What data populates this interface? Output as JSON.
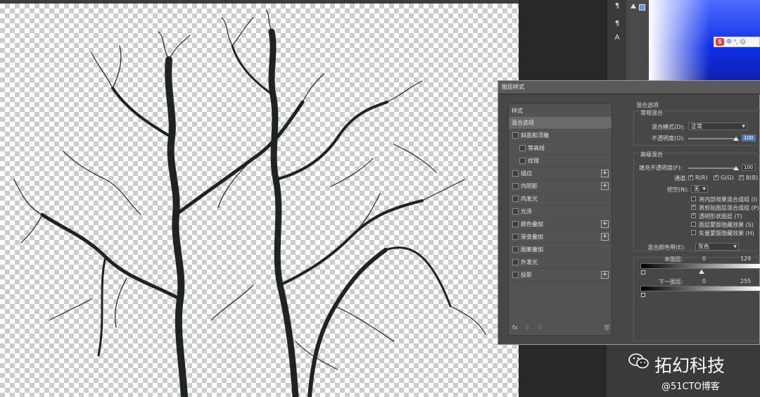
{
  "dialog": {
    "title": "图层样式",
    "styles_header": "样式",
    "styles": [
      {
        "label": "混合选项",
        "active": true,
        "checkbox": false,
        "plus": false,
        "indent": 0
      },
      {
        "label": "斜面和浮雕",
        "active": false,
        "checkbox": true,
        "plus": false,
        "indent": 0
      },
      {
        "label": "等高线",
        "active": false,
        "checkbox": true,
        "plus": false,
        "indent": 1
      },
      {
        "label": "纹理",
        "active": false,
        "checkbox": true,
        "plus": false,
        "indent": 1
      },
      {
        "label": "描边",
        "active": false,
        "checkbox": true,
        "plus": true,
        "indent": 0
      },
      {
        "label": "内阴影",
        "active": false,
        "checkbox": true,
        "plus": true,
        "indent": 0
      },
      {
        "label": "内发光",
        "active": false,
        "checkbox": true,
        "plus": false,
        "indent": 0
      },
      {
        "label": "光泽",
        "active": false,
        "checkbox": true,
        "plus": false,
        "indent": 0
      },
      {
        "label": "颜色叠加",
        "active": false,
        "checkbox": true,
        "plus": true,
        "indent": 0
      },
      {
        "label": "渐变叠加",
        "active": false,
        "checkbox": true,
        "plus": true,
        "indent": 0
      },
      {
        "label": "图案叠加",
        "active": false,
        "checkbox": true,
        "plus": false,
        "indent": 0
      },
      {
        "label": "外发光",
        "active": false,
        "checkbox": true,
        "plus": false,
        "indent": 0
      },
      {
        "label": "投影",
        "active": false,
        "checkbox": true,
        "plus": true,
        "indent": 0
      }
    ],
    "footer": {
      "fx": "fx",
      "up": "⇧",
      "down": "⇩",
      "trash": "🗑"
    },
    "blend_options_title": "混合选项",
    "general_blending": {
      "title": "常规混合",
      "mode_label": "混合模式(D):",
      "mode_value": "正常",
      "opacity_label": "不透明度(O):",
      "opacity_value": "100"
    },
    "advanced_blending": {
      "title": "高级混合",
      "fill_label": "填充不透明度(F):",
      "fill_value": "100",
      "channels_label": "通道:",
      "channels": [
        {
          "label": "R(R)",
          "checked": true
        },
        {
          "label": "G(G)",
          "checked": true
        },
        {
          "label": "B(B)",
          "checked": true
        }
      ],
      "knockout_label": "挖空(N):",
      "knockout_value": "无",
      "options": [
        {
          "label": "将内部效果混合成组 (I)",
          "checked": false
        },
        {
          "label": "将剪贴图层混合成组 (P)",
          "checked": true
        },
        {
          "label": "透明形状图层 (T)",
          "checked": true
        },
        {
          "label": "图层蒙版隐藏效果 (S)",
          "checked": false
        },
        {
          "label": "矢量蒙版隐藏效果 (H)",
          "checked": false
        }
      ]
    },
    "blend_if": {
      "label": "混合颜色带(E):",
      "value": "灰色",
      "this_layer_label": "本图层:",
      "this_layer_values": [
        "0",
        "129"
      ],
      "underlying_label": "下一图层:",
      "underlying_values": [
        "0",
        "255"
      ]
    }
  },
  "ime": {
    "s": "S",
    "text": "中 °, ☺"
  },
  "watermark": {
    "name": "拓幻科技",
    "source": "@51CTO博客"
  },
  "colors": {
    "accent": "#4f79c8",
    "dialog_bg": "#474747",
    "canvas_check": "#cccccc"
  }
}
